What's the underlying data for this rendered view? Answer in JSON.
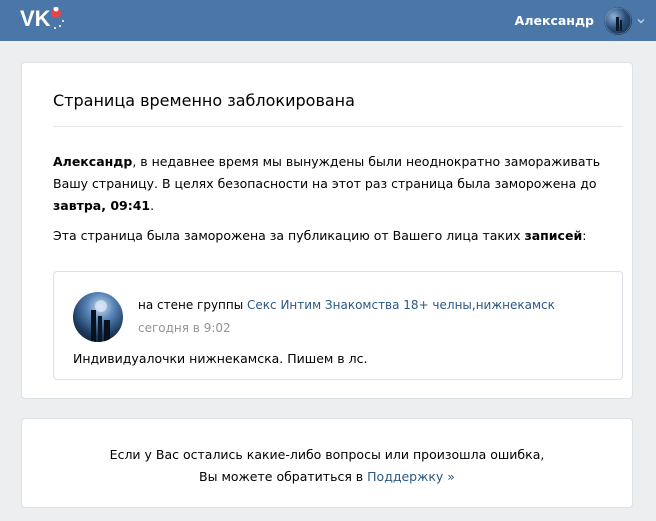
{
  "header": {
    "logo_icon": "vk-logo-icon",
    "user_name": "Александр",
    "avatar_icon": "user-avatar",
    "menu_icon": "chevron-down-icon",
    "bg_color": "#4a76a8"
  },
  "main": {
    "title": "Страница временно заблокирована",
    "para1": {
      "name": "Александр",
      "text1": ", в недавнее время мы вынуждены были неоднократно замораживать Вашу страницу. В целях безопасности на этот раз страница была заморожена до ",
      "until": "завтра, 09:41",
      "end": "."
    },
    "para2": {
      "text": "Эта страница была заморожена за публикацию от Вашего лица таких ",
      "bold": "записей",
      "end": ":"
    },
    "post": {
      "prefix": "на стене группы ",
      "group": "Секс Интим Знакомства 18+ челны,нижнекамск",
      "time": "сегодня в 9:02",
      "text": "Индивидуалочки нижнекамска. Пишем в лс."
    }
  },
  "support": {
    "line1": "Если у Вас остались какие-либо вопросы или произошла ошибка,",
    "line2_prefix": "Вы можете обратиться в ",
    "link": "Поддержку »"
  },
  "colors": {
    "link": "#2a5885",
    "muted": "#939393",
    "page_bg": "#edeef0"
  }
}
